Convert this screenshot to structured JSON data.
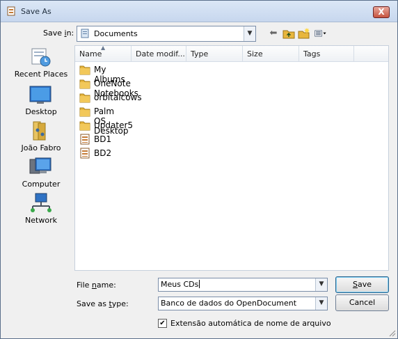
{
  "window": {
    "title": "Save As",
    "close_label": "X"
  },
  "save_in": {
    "label_pre": "Save ",
    "label_key": "i",
    "label_post": "n:",
    "value": "Documents"
  },
  "places": [
    {
      "label": "Recent Places"
    },
    {
      "label": "Desktop"
    },
    {
      "label": "João Fabro"
    },
    {
      "label": "Computer"
    },
    {
      "label": "Network"
    }
  ],
  "columns": [
    "Name",
    "Date modif...",
    "Type",
    "Size",
    "Tags"
  ],
  "files": [
    {
      "name": "My Albums",
      "kind": "folder"
    },
    {
      "name": "OneNote Notebooks",
      "kind": "folder"
    },
    {
      "name": "orbitalcows",
      "kind": "folder"
    },
    {
      "name": "Palm OS Desktop",
      "kind": "folder"
    },
    {
      "name": "Updater5",
      "kind": "folder"
    },
    {
      "name": "BD1",
      "kind": "document"
    },
    {
      "name": "BD2",
      "kind": "document"
    }
  ],
  "file_name": {
    "label_pre": "File ",
    "label_key": "n",
    "label_post": "ame:",
    "value": "Meus CDs"
  },
  "save_type": {
    "label_pre": "Save as ",
    "label_key": "t",
    "label_post": "ype:",
    "value": "Banco de dados do OpenDocument"
  },
  "buttons": {
    "save_key": "S",
    "save_rest": "ave",
    "cancel": "Cancel"
  },
  "auto_ext": {
    "checked": true,
    "label": "Extensão automática de nome de arquivo"
  },
  "colors": {
    "folder": "#e8b63c",
    "accent": "#2c628b"
  }
}
